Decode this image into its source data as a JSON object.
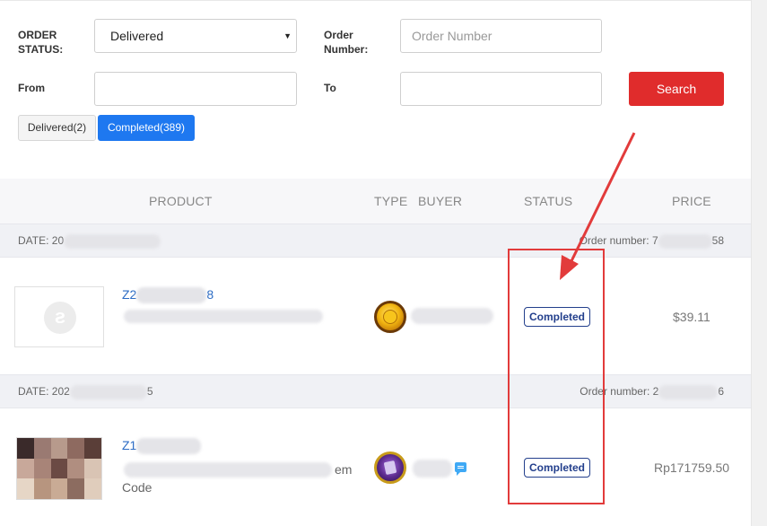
{
  "filters": {
    "order_status_label": "ORDER STATUS:",
    "order_status_value": "Delivered",
    "order_number_label": "Order Number:",
    "order_number_placeholder": "Order Number",
    "from_label": "From",
    "to_label": "To",
    "search_label": "Search"
  },
  "status_tabs": [
    {
      "label": "Delivered(2)",
      "active": false
    },
    {
      "label": "Completed(389)",
      "active": true
    }
  ],
  "table": {
    "headers": {
      "product": "PRODUCT",
      "type": "TYPE",
      "buyer": "BUYER",
      "status": "STATUS",
      "price": "PRICE"
    }
  },
  "orders": [
    {
      "date_prefix": "DATE: 20",
      "order_number_prefix": "Order number: 7",
      "order_number_suffix": "58",
      "product_name_start": "Z2",
      "product_name_end": "8",
      "product_desc": "",
      "type_icon": "gold-coin-icon",
      "status": "Completed",
      "price": "$39.11"
    },
    {
      "date_prefix": "DATE: 202",
      "date_suffix": "5",
      "order_number_prefix": "Order number: 2",
      "order_number_suffix": "6",
      "product_name_start": "Z1",
      "product_desc_end": "em",
      "product_desc_line2": "Code",
      "type_icon": "purple-gem-icon",
      "status": "Completed",
      "price": "Rp171759.50"
    }
  ],
  "colors": {
    "search_button": "#e02c2c",
    "active_tab": "#1e78f0",
    "badge": "#233f8c",
    "annotation": "#e23b3b"
  }
}
